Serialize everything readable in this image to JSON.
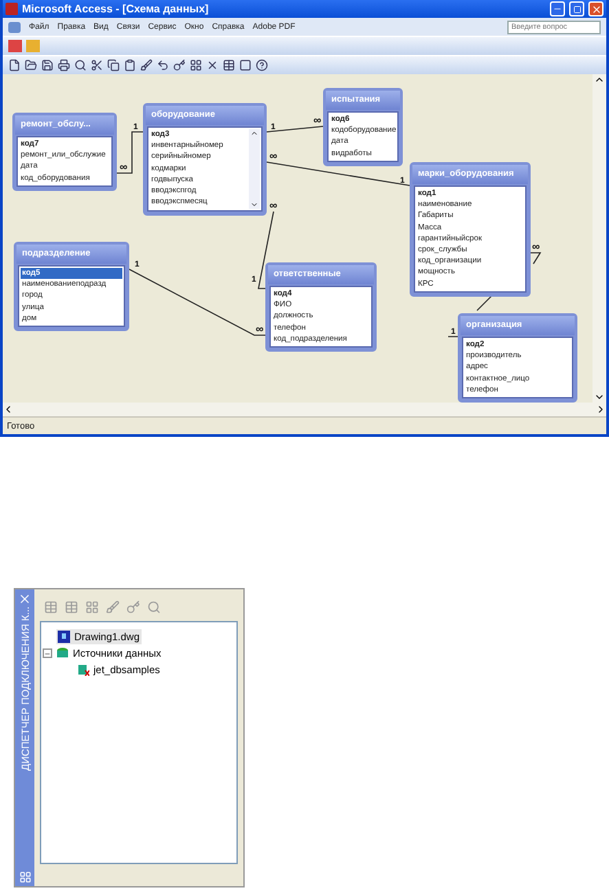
{
  "window": {
    "title": "Microsoft Access - [Схема данных]"
  },
  "menu": [
    "Файл",
    "Правка",
    "Вид",
    "Связи",
    "Сервис",
    "Окно",
    "Справка",
    "Adobe PDF"
  ],
  "help_search": {
    "placeholder": "Введите вопрос"
  },
  "tables": [
    {
      "title": "ремонт_обслу...",
      "scrollbar": false,
      "fields": [
        {
          "name": "код7",
          "key": true,
          "selected": false
        },
        {
          "name": "ремонт_или_обслужие",
          "key": false,
          "selected": false
        },
        {
          "name": "дата",
          "key": false,
          "selected": false
        },
        {
          "name": "код_оборудования",
          "key": false,
          "selected": false
        }
      ]
    },
    {
      "title": "оборудование",
      "scrollbar": true,
      "fields": [
        {
          "name": "код3",
          "key": true,
          "selected": false
        },
        {
          "name": "инвентарныйномер",
          "key": false,
          "selected": false
        },
        {
          "name": "серийныйномер",
          "key": false,
          "selected": false
        },
        {
          "name": "кодмарки",
          "key": false,
          "selected": false
        },
        {
          "name": "годвыпуска",
          "key": false,
          "selected": false
        },
        {
          "name": "вводэкспгод",
          "key": false,
          "selected": false
        },
        {
          "name": "вводэкспмесяц",
          "key": false,
          "selected": false
        }
      ]
    },
    {
      "title": "испытания",
      "scrollbar": false,
      "fields": [
        {
          "name": "код6",
          "key": true,
          "selected": false
        },
        {
          "name": "кодоборудование",
          "key": false,
          "selected": false
        },
        {
          "name": "дата",
          "key": false,
          "selected": false
        },
        {
          "name": "видработы",
          "key": false,
          "selected": false
        }
      ]
    },
    {
      "title": "марки_оборудования",
      "scrollbar": false,
      "fields": [
        {
          "name": "код1",
          "key": true,
          "selected": false
        },
        {
          "name": "наименование",
          "key": false,
          "selected": false
        },
        {
          "name": "Габариты",
          "key": false,
          "selected": false
        },
        {
          "name": "Масса",
          "key": false,
          "selected": false
        },
        {
          "name": "гарантийныйсрок",
          "key": false,
          "selected": false
        },
        {
          "name": "срок_службы",
          "key": false,
          "selected": false
        },
        {
          "name": "код_организации",
          "key": false,
          "selected": false
        },
        {
          "name": "мощность",
          "key": false,
          "selected": false
        },
        {
          "name": "КРС",
          "key": false,
          "selected": false
        }
      ]
    },
    {
      "title": "подразделение",
      "scrollbar": false,
      "fields": [
        {
          "name": "код5",
          "key": true,
          "selected": true
        },
        {
          "name": "наименованиеподразд",
          "key": false,
          "selected": false
        },
        {
          "name": "город",
          "key": false,
          "selected": false
        },
        {
          "name": "улица",
          "key": false,
          "selected": false
        },
        {
          "name": "дом",
          "key": false,
          "selected": false
        }
      ]
    },
    {
      "title": "ответственные",
      "scrollbar": false,
      "fields": [
        {
          "name": "код4",
          "key": true,
          "selected": false
        },
        {
          "name": "ФИО",
          "key": false,
          "selected": false
        },
        {
          "name": "должность",
          "key": false,
          "selected": false
        },
        {
          "name": "телефон",
          "key": false,
          "selected": false
        },
        {
          "name": "код_подразделения",
          "key": false,
          "selected": false
        }
      ]
    },
    {
      "title": "организация",
      "scrollbar": false,
      "fields": [
        {
          "name": "код2",
          "key": true,
          "selected": false
        },
        {
          "name": "производитель",
          "key": false,
          "selected": false
        },
        {
          "name": "адрес",
          "key": false,
          "selected": false
        },
        {
          "name": "контактное_лицо",
          "key": false,
          "selected": false
        },
        {
          "name": "телефон",
          "key": false,
          "selected": false
        }
      ]
    }
  ],
  "relationships": [
    {
      "one": "1",
      "many": "∞"
    },
    {
      "one": "1",
      "many": "∞"
    },
    {
      "one": "1",
      "many": "∞"
    },
    {
      "one": "1",
      "many": "∞"
    },
    {
      "one": "1",
      "many": "∞"
    },
    {
      "one": "1",
      "many": "∞"
    }
  ],
  "status_bar": "Готово",
  "connection_manager": {
    "title": "ДИСПЕТЧЕР ПОДКЛЮЧЕНИЯ К...",
    "tree": [
      {
        "label": "Drawing1.dwg",
        "kind": "drawing",
        "selected": true
      },
      {
        "label": "Источники данных",
        "kind": "folder",
        "selected": false,
        "expanded": true,
        "children": [
          {
            "label": "jet_dbsamples",
            "kind": "source",
            "selected": false
          }
        ]
      }
    ]
  }
}
